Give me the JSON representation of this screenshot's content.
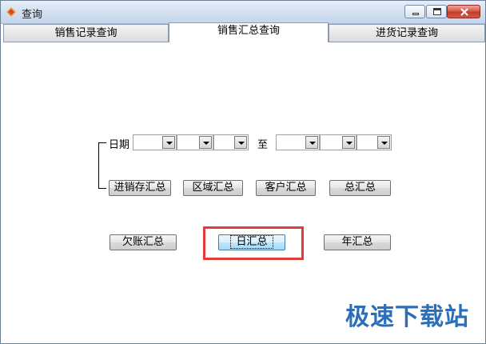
{
  "window": {
    "title": "查询"
  },
  "tabs": [
    {
      "label": "销售记录查询"
    },
    {
      "label": "销售汇总查询"
    },
    {
      "label": "进货记录查询"
    }
  ],
  "date": {
    "label": "日期",
    "to": "至"
  },
  "buttons": {
    "row1": [
      "进销存汇总",
      "区域汇总",
      "客户汇总",
      "总汇总"
    ],
    "row2": [
      "欠账汇总",
      "日汇总",
      "年汇总"
    ]
  },
  "watermark": "极速下载站",
  "colors": {
    "highlight": "#e03c3c",
    "watermark": "#2b6fb8"
  }
}
